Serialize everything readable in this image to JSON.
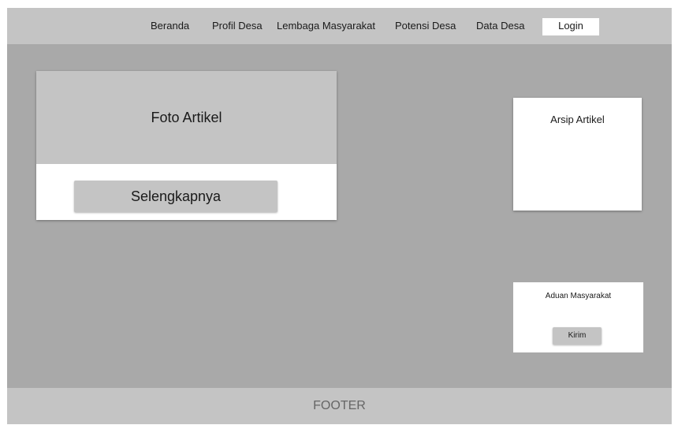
{
  "navbar": {
    "items": [
      "Beranda",
      "Profil Desa",
      "Lembaga Masyarakat",
      "Potensi Desa",
      "Data Desa"
    ],
    "login_label": "Login"
  },
  "article": {
    "photo_label": "Foto Artikel",
    "read_more_label": "Selengkapnya"
  },
  "archive": {
    "title": "Arsip Artikel"
  },
  "complaint": {
    "title": "Aduan Masyarakat",
    "send_label": "Kirim"
  },
  "footer": {
    "label": "FOOTER"
  },
  "colors": {
    "background": "#a9a9a9",
    "bar": "#c4c4c4",
    "card": "#ffffff"
  }
}
